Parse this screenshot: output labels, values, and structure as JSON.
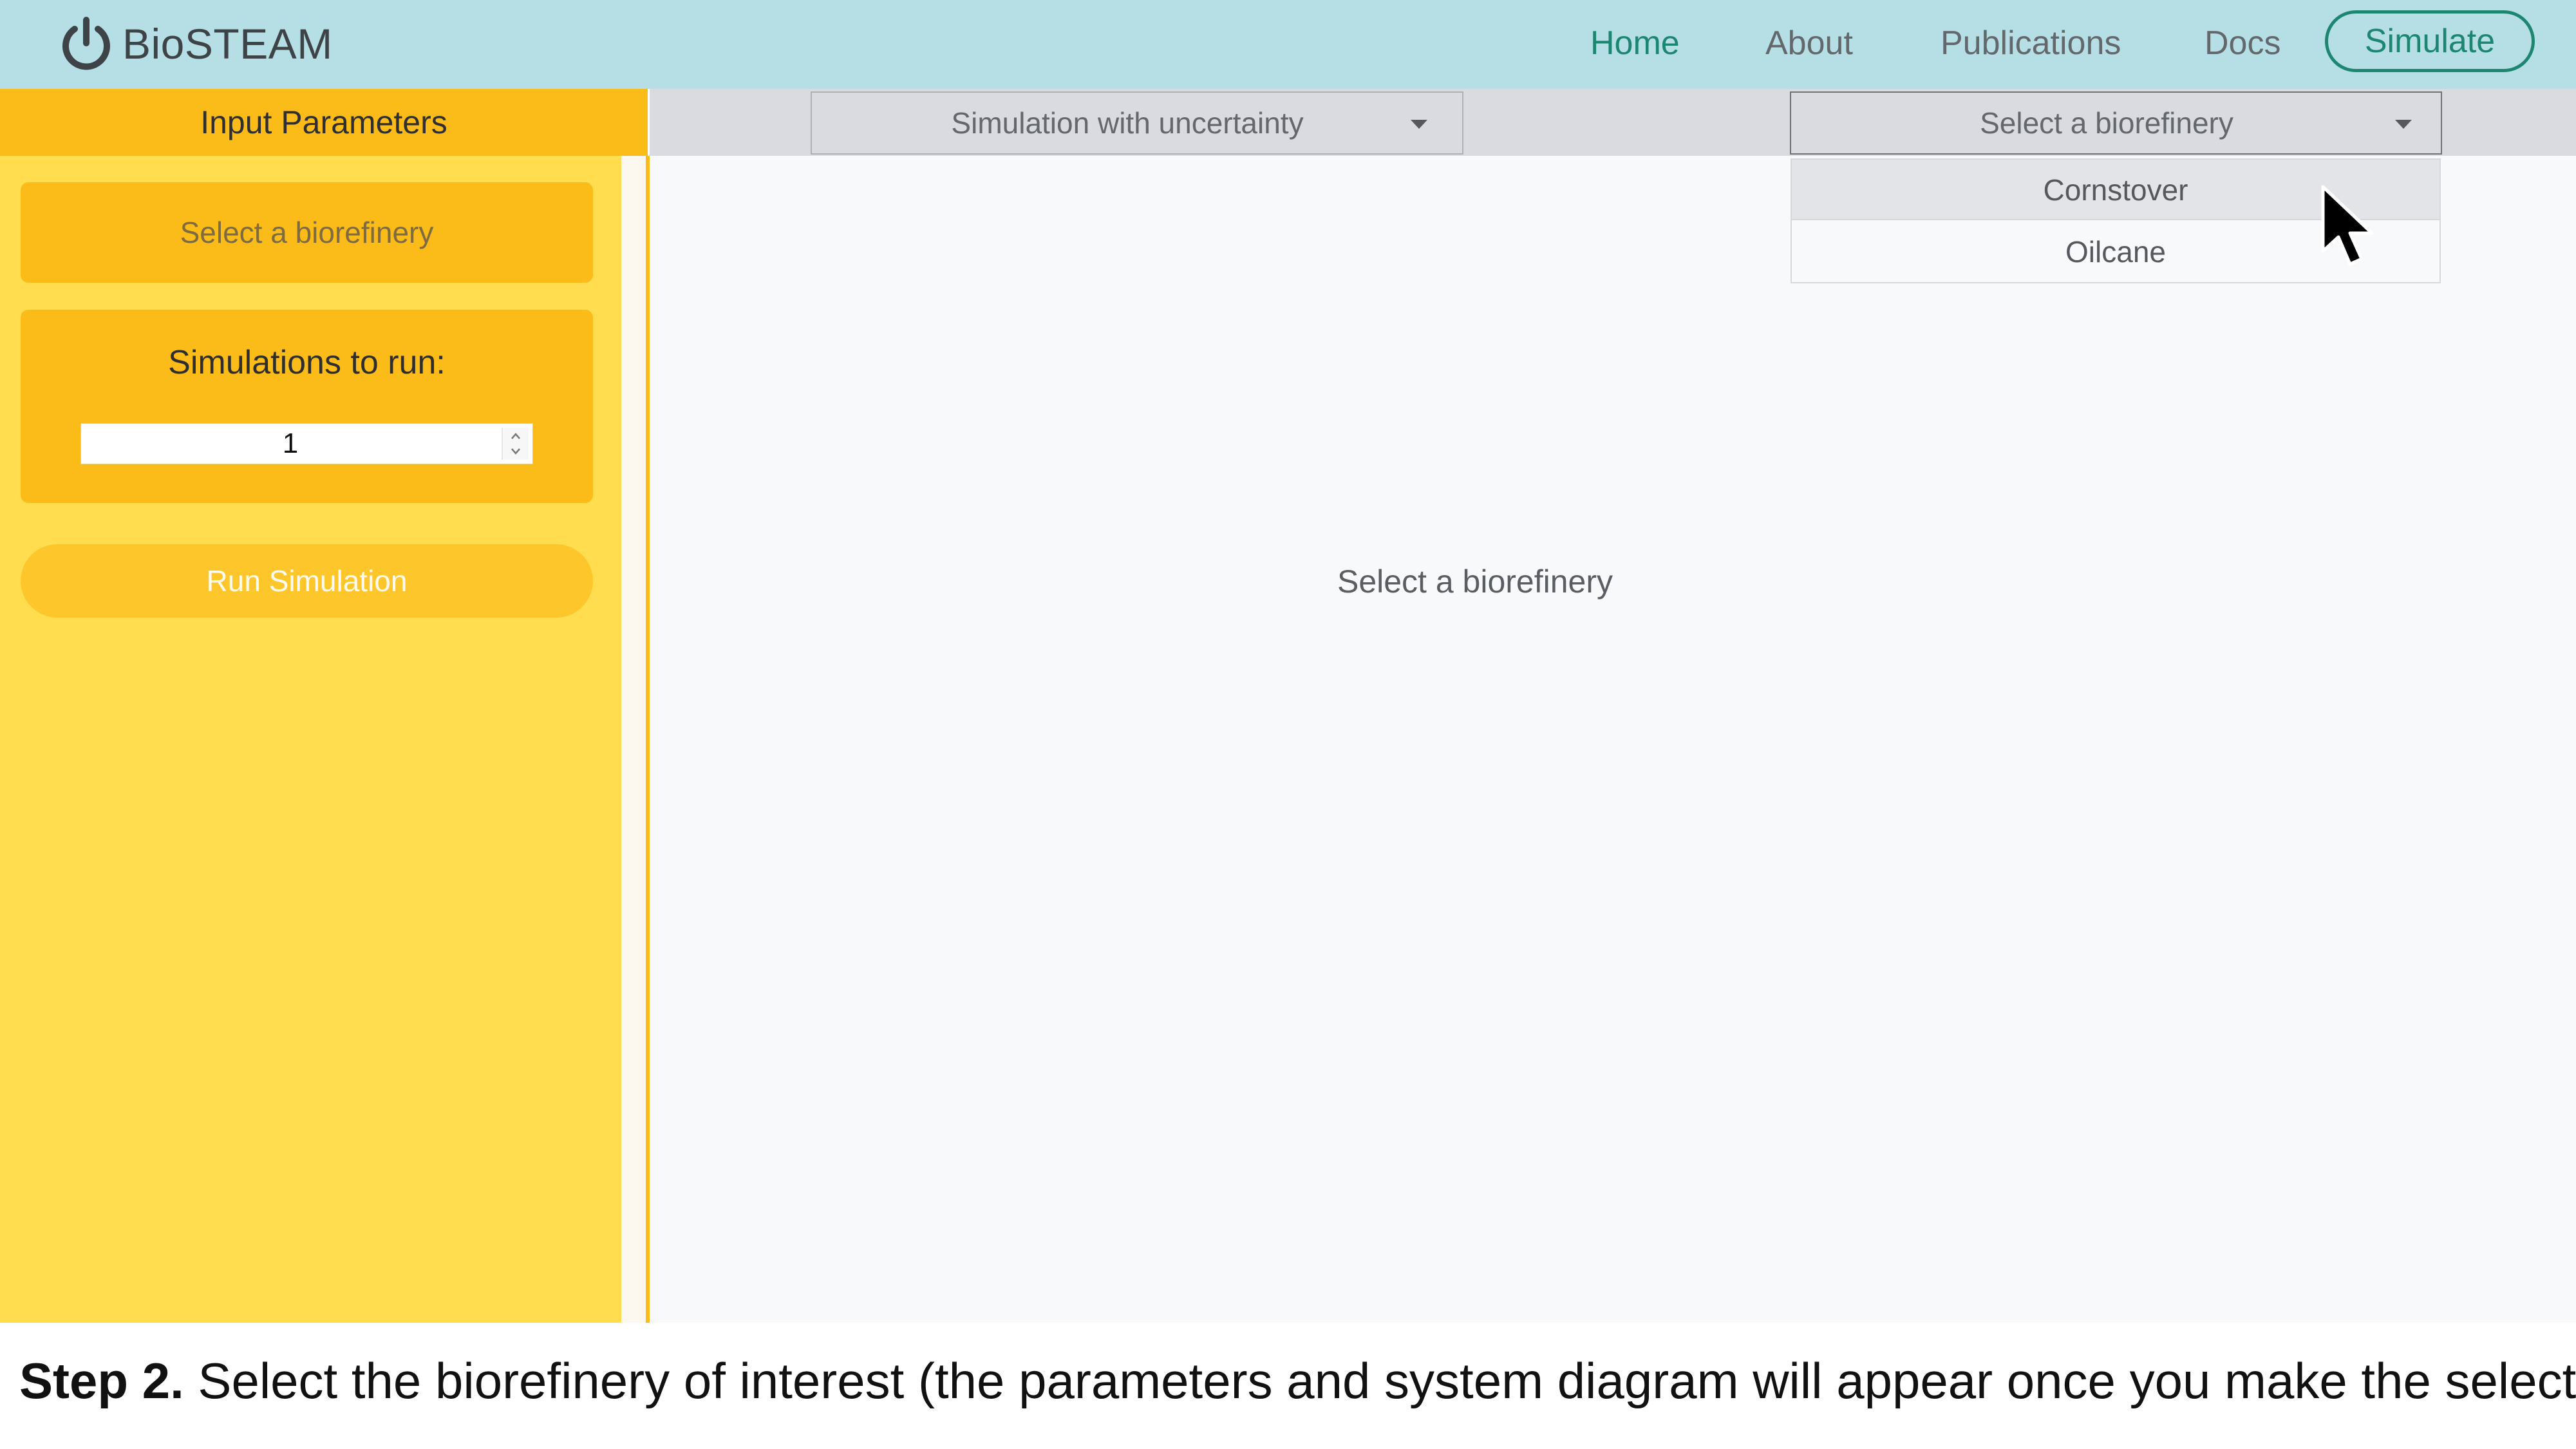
{
  "navbar": {
    "brand": "BioSTEAM",
    "links": [
      "Home",
      "About",
      "Publications",
      "Docs"
    ],
    "active": "Home",
    "cta": "Simulate",
    "colors": {
      "background": "#b6dfe5",
      "accent": "#1c8672"
    }
  },
  "sidebar": {
    "header": "Input Parameters",
    "select_prompt": "Select a biorefinery",
    "sims_label": "Simulations to run:",
    "sims_value": "1",
    "run_button": "Run Simulation",
    "colors": {
      "header": "#fbbb19",
      "panel": "#ffdd4e"
    }
  },
  "toolbar": {
    "mode_dropdown": "Simulation with uncertainty",
    "biorefinery_dropdown": "Select a biorefinery"
  },
  "dropdown_menu": {
    "options": [
      "Cornstover",
      "Oilcane"
    ],
    "hovered": "Cornstover"
  },
  "main": {
    "placeholder": "Select a biorefinery"
  },
  "caption": {
    "step": "Step 2.",
    "text": " Select the biorefinery of interest (the parameters and system diagram will appear once you make the selection)."
  },
  "icons": {
    "brand": "power-icon",
    "dropdown": "caret-down-icon",
    "spinner": "spinner-arrows-icon",
    "pointer": "mouse-cursor-icon"
  }
}
